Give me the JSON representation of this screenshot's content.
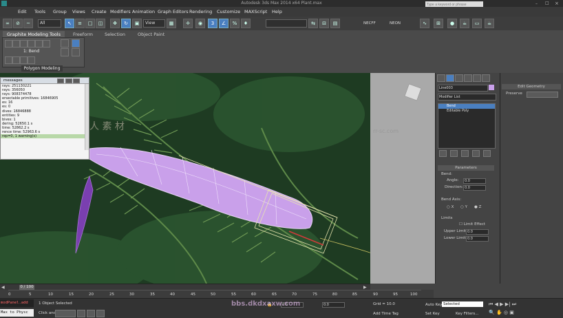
{
  "window": {
    "title": "Autodesk 3ds Max  2014 x64   Plant.max"
  },
  "search": {
    "placeholder": "Type a keyword or phrase"
  },
  "menu": [
    "Edit",
    "Tools",
    "Group",
    "Views",
    "Create",
    "Modifiers",
    "Animation",
    "Graph Editors",
    "Rendering",
    "Customize",
    "MAXScript",
    "Help"
  ],
  "toolbar": {
    "filter": "All",
    "view": "View",
    "pct": "3",
    "named_sel_a": "NECFF",
    "named_sel_b": "NEON"
  },
  "ribbon": {
    "tabs": [
      "Graphite Modeling Tools",
      "Freeform",
      "Selection",
      "Object Paint"
    ],
    "panel_item": "1: Bend",
    "panel_label": "Polygon Modeling"
  },
  "messages": {
    "title": "messages",
    "lines": [
      "rays: 251130221",
      "rays: 356050",
      "rays: 908374478",
      "ersectable primitives: 16846905",
      "es: 16",
      "es: 0",
      "dives: 16846888",
      "entities: 9",
      "bives: 1",
      "dering: 52650.1 s",
      "time: 52862.2 s",
      "rence time: 52963.6 s",
      "rep=0, 1 warning(s)"
    ]
  },
  "command_panel": {
    "object_name": "Line003",
    "modifier_list": "Modifier List",
    "stack": [
      "Bend",
      "Editable Poly"
    ],
    "params_title": "Parameters",
    "bend_label": "Bend:",
    "angle_label": "Angle:",
    "angle_value": "0.0",
    "direction_label": "Direction:",
    "direction_value": "0.0",
    "axis_label": "Bend Axis:",
    "axes": [
      "X",
      "Y",
      "Z"
    ],
    "limits_label": "Limits",
    "limit_effect": "Limit Effect",
    "upper_label": "Upper Limit:",
    "upper_value": "0.0",
    "lower_label": "Lower Limit:",
    "lower_value": "0.0"
  },
  "edit_geometry": {
    "title": "Edit Geometry",
    "preserve": "Preserve"
  },
  "timeline": {
    "frame": "0 / 100",
    "ticks": [
      "0",
      "5",
      "10",
      "15",
      "20",
      "25",
      "30",
      "35",
      "40",
      "45",
      "50",
      "55",
      "60",
      "65",
      "70",
      "75",
      "80",
      "85",
      "90",
      "95",
      "100"
    ]
  },
  "status": {
    "script1": "modPanel.add",
    "script2": "Max to Physc",
    "selected": "1 Object Selected",
    "click_and": "Click and",
    "grid": "Grid = 10.0",
    "add_time_tag": "Add Time Tag",
    "auto_key": "Auto Key",
    "selected_dd": "Selected",
    "set_key": "Set Key",
    "key_filters": "Key Filters...",
    "coord_x": "0.0",
    "coord_y": "0.0"
  },
  "watermarks": [
    "人 素 材",
    "rr-sc.com",
    "bbs.dkdxaxw.com"
  ],
  "colors": {
    "selection": "#4a7fc0",
    "leaf": "#c79be8",
    "viewport_bg": "#1d3a20"
  }
}
